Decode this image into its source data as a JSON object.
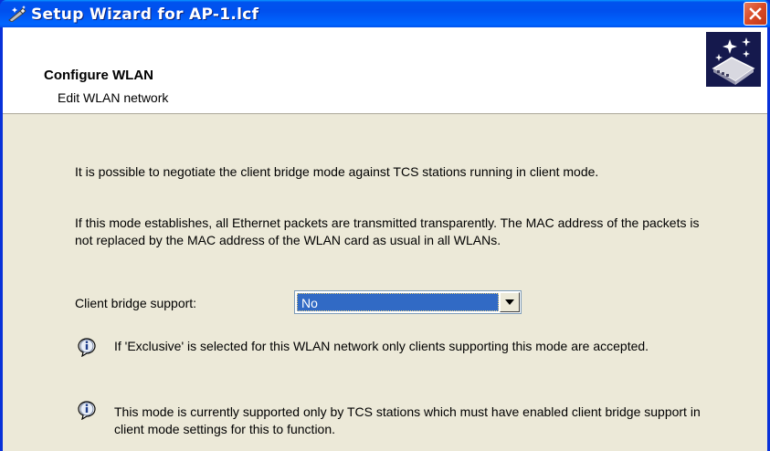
{
  "window": {
    "title": "Setup Wizard for AP-1.lcf"
  },
  "header": {
    "title": "Configure WLAN",
    "subtitle": "Edit WLAN network"
  },
  "body": {
    "para1": "It is possible to negotiate the client bridge mode against TCS stations running in client mode.",
    "para2": "If this mode establishes, all Ethernet packets are transmitted transparently. The MAC address of the packets is not replaced by the MAC address of the WLAN card as usual in all WLANs.",
    "bridge_label": "Client bridge support:",
    "bridge_value": "No",
    "info1": "If 'Exclusive' is selected for this WLAN network only clients supporting this mode are accepted.",
    "info2": "This mode is currently supported only by TCS stations which must have enabled client bridge support in client mode settings for this to function."
  },
  "icons": {
    "title": "wizard-wand-icon",
    "close": "close-icon",
    "header": "network-device-sparkle-icon",
    "info": "info-icon",
    "dropdown": "chevron-down-icon"
  },
  "colors": {
    "titlebar": "#0054e3",
    "close": "#d94a25",
    "dialog_bg": "#ece9d8",
    "selection": "#316ac5"
  }
}
